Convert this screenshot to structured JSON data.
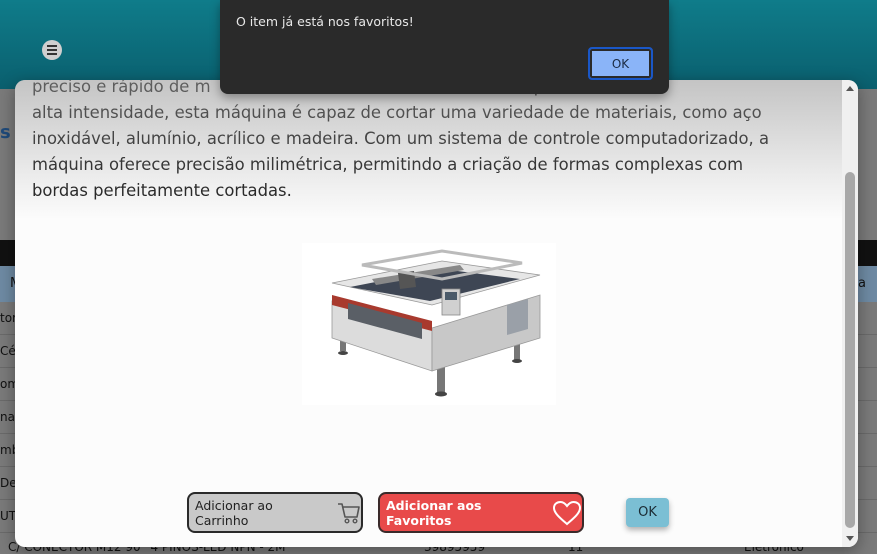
{
  "alert": {
    "message": "O item já está nos favoritos!",
    "ok_label": "OK"
  },
  "modal": {
    "description_lines": [
      "preciso e rápido de m                                                              potente laser de",
      "alta intensidade, esta máquina é capaz de cortar uma variedade de materiais, como aço",
      "inoxidável, alumínio, acrílico e madeira. Com um sistema de controle computadorizado, a",
      "máquina oferece precisão milimétrica, permitindo a criação de formas complexas com",
      "bordas perfeitamente cortadas."
    ],
    "cart_button_label": "Adicionar ao Carrinho",
    "favorites_button_label": "Adicionar aos Favoritos",
    "ok_label": "OK"
  },
  "background": {
    "header_col_first": "M",
    "header_col_last": "a",
    "rows": [
      "tor",
      "Cél",
      "om",
      "na",
      "mb",
      "De",
      "UT"
    ],
    "last_row": {
      "name": "C/ CONECTOR M12 90° 4 PINOS-LED NPN - 2M",
      "code": "39895959",
      "qty": "11",
      "category": "Eletrônico"
    }
  },
  "icons": {
    "menu": "hamburger-menu-icon",
    "cart": "cart-icon",
    "favorite": "heart-icon"
  },
  "colors": {
    "header": "#0f7c8a",
    "favorites_button": "#e84a4a",
    "ok_button": "#7bbfd4",
    "alert_bg": "#2a2a2a"
  }
}
